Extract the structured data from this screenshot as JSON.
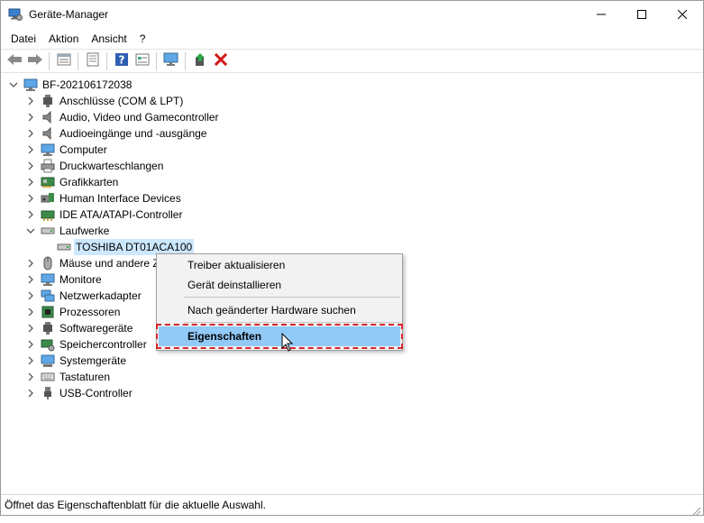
{
  "window": {
    "title": "Geräte-Manager",
    "minimize_icon": "minimize-icon",
    "maximize_icon": "maximize-icon",
    "close_icon": "close-icon"
  },
  "menubar": {
    "items": [
      "Datei",
      "Aktion",
      "Ansicht",
      "?"
    ]
  },
  "toolbar": {
    "buttons": [
      "back-arrow-icon",
      "forward-arrow-icon",
      "show-hidden-icon",
      "properties-icon",
      "help-icon",
      "view-icon",
      "monitor-scan-icon",
      "update-driver-icon",
      "uninstall-icon"
    ]
  },
  "tree": {
    "root": "BF-20210617203­8",
    "categories": [
      {
        "label": "Anschlüsse (COM & LPT)",
        "icon": "port-icon"
      },
      {
        "label": "Audio, Video und Gamecontroller",
        "icon": "speaker-icon"
      },
      {
        "label": "Audioeingänge und -ausgänge",
        "icon": "speaker-icon"
      },
      {
        "label": "Computer",
        "icon": "computer-icon"
      },
      {
        "label": "Druckwarteschlangen",
        "icon": "printer-icon"
      },
      {
        "label": "Grafikkarten",
        "icon": "display-adapter-icon"
      },
      {
        "label": "Human Interface Devices",
        "icon": "hid-icon"
      },
      {
        "label": "IDE ATA/ATAPI-Controller",
        "icon": "ide-controller-icon"
      },
      {
        "label": "Laufwerke",
        "icon": "drive-icon"
      },
      {
        "label": "TOSHIBA DT01ACA100",
        "icon": "drive-icon"
      },
      {
        "label": "Mäuse und andere Z",
        "icon": "mouse-icon"
      },
      {
        "label": "Monitore",
        "icon": "monitor-icon"
      },
      {
        "label": "Netzwerkadapter",
        "icon": "network-icon"
      },
      {
        "label": "Prozessoren",
        "icon": "processor-icon"
      },
      {
        "label": "Softwaregeräte",
        "icon": "software-device-icon"
      },
      {
        "label": "Speichercontroller",
        "icon": "storage-controller-icon"
      },
      {
        "label": "Systemgeräte",
        "icon": "system-device-icon"
      },
      {
        "label": "Tastaturen",
        "icon": "keyboard-icon"
      },
      {
        "label": "USB-Controller",
        "icon": "usb-icon"
      }
    ]
  },
  "context_menu": {
    "update_driver": "Treiber aktualisieren",
    "uninstall": "Gerät deinstallieren",
    "scan_hardware": "Nach geänderter Hardware suchen",
    "properties": "Eigenschaften"
  },
  "status": {
    "text": "Öffnet das Eigenschaftenblatt für die aktuelle Auswahl."
  },
  "colors": {
    "selection": "#cce8ff",
    "menu_highlight": "#91c9f7",
    "annotation_border": "#d7262c",
    "uninstall_red": "#d11919"
  }
}
